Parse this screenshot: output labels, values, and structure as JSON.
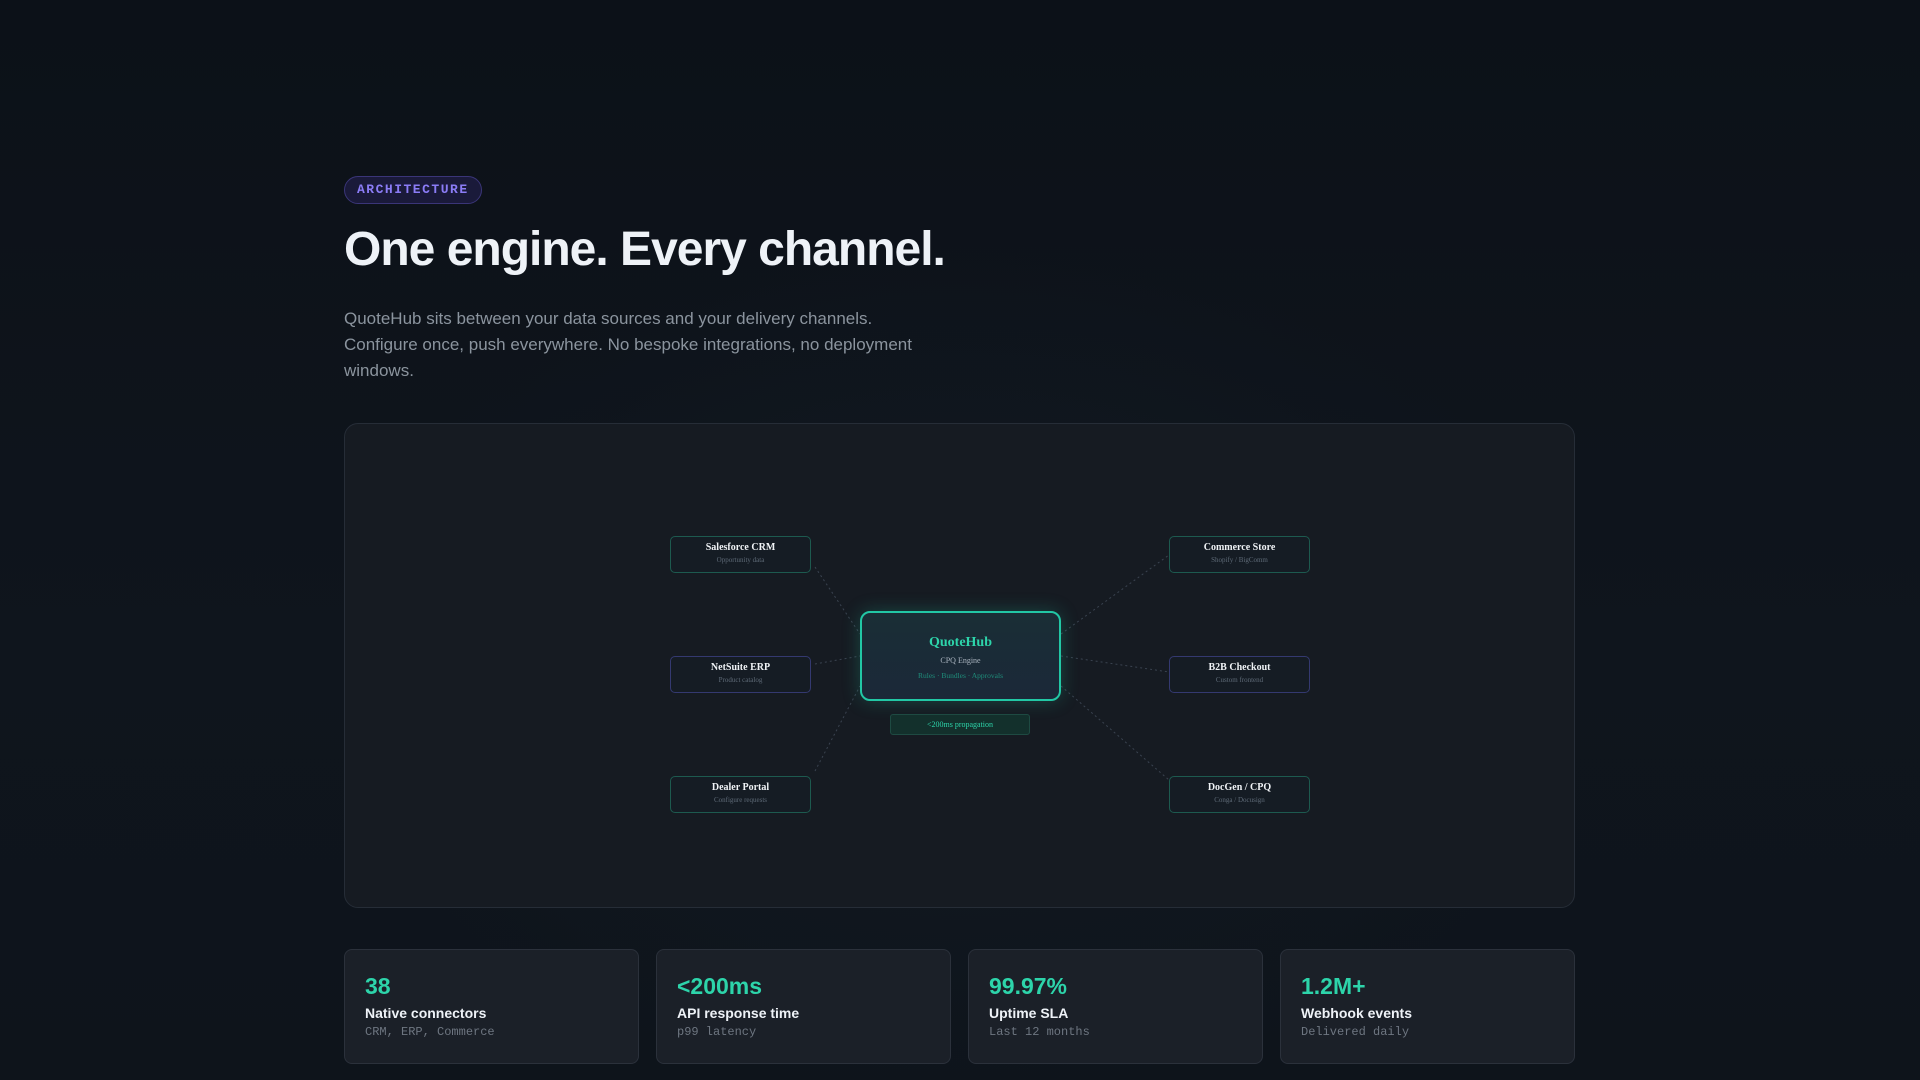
{
  "header": {
    "tag": "ARCHITECTURE",
    "title": "One engine. Every channel.",
    "subtitle": "QuoteHub sits between your data sources and your delivery channels. Configure once, push everywhere. No bespoke integrations, no deployment windows."
  },
  "diagram": {
    "hub": {
      "title": "QuoteHub",
      "subtitle": "CPQ Engine",
      "features": "Rules · Bundles · Approvals"
    },
    "propagation": "<200ms propagation",
    "sources": [
      {
        "title": "Salesforce CRM",
        "subtitle": "Opportunity data"
      },
      {
        "title": "NetSuite ERP",
        "subtitle": "Product catalog"
      },
      {
        "title": "Dealer Portal",
        "subtitle": "Configure requests"
      }
    ],
    "channels": [
      {
        "title": "Commerce Store",
        "subtitle": "Shopify / BigComm"
      },
      {
        "title": "B2B Checkout",
        "subtitle": "Custom frontend"
      },
      {
        "title": "DocGen / CPQ",
        "subtitle": "Conga / Docusign"
      }
    ],
    "colors": {
      "accent": "#2dd4aa",
      "teal_border": "#1d5a4f",
      "indigo_border": "#343970"
    }
  },
  "stats": [
    {
      "value": "38",
      "label": "Native connectors",
      "sub": "CRM, ERP, Commerce"
    },
    {
      "value": "<200ms",
      "label": "API response time",
      "sub": "p99 latency"
    },
    {
      "value": "99.97%",
      "label": "Uptime SLA",
      "sub": "Last 12 months"
    },
    {
      "value": "1.2M+",
      "label": "Webhook events",
      "sub": "Delivered daily"
    }
  ]
}
